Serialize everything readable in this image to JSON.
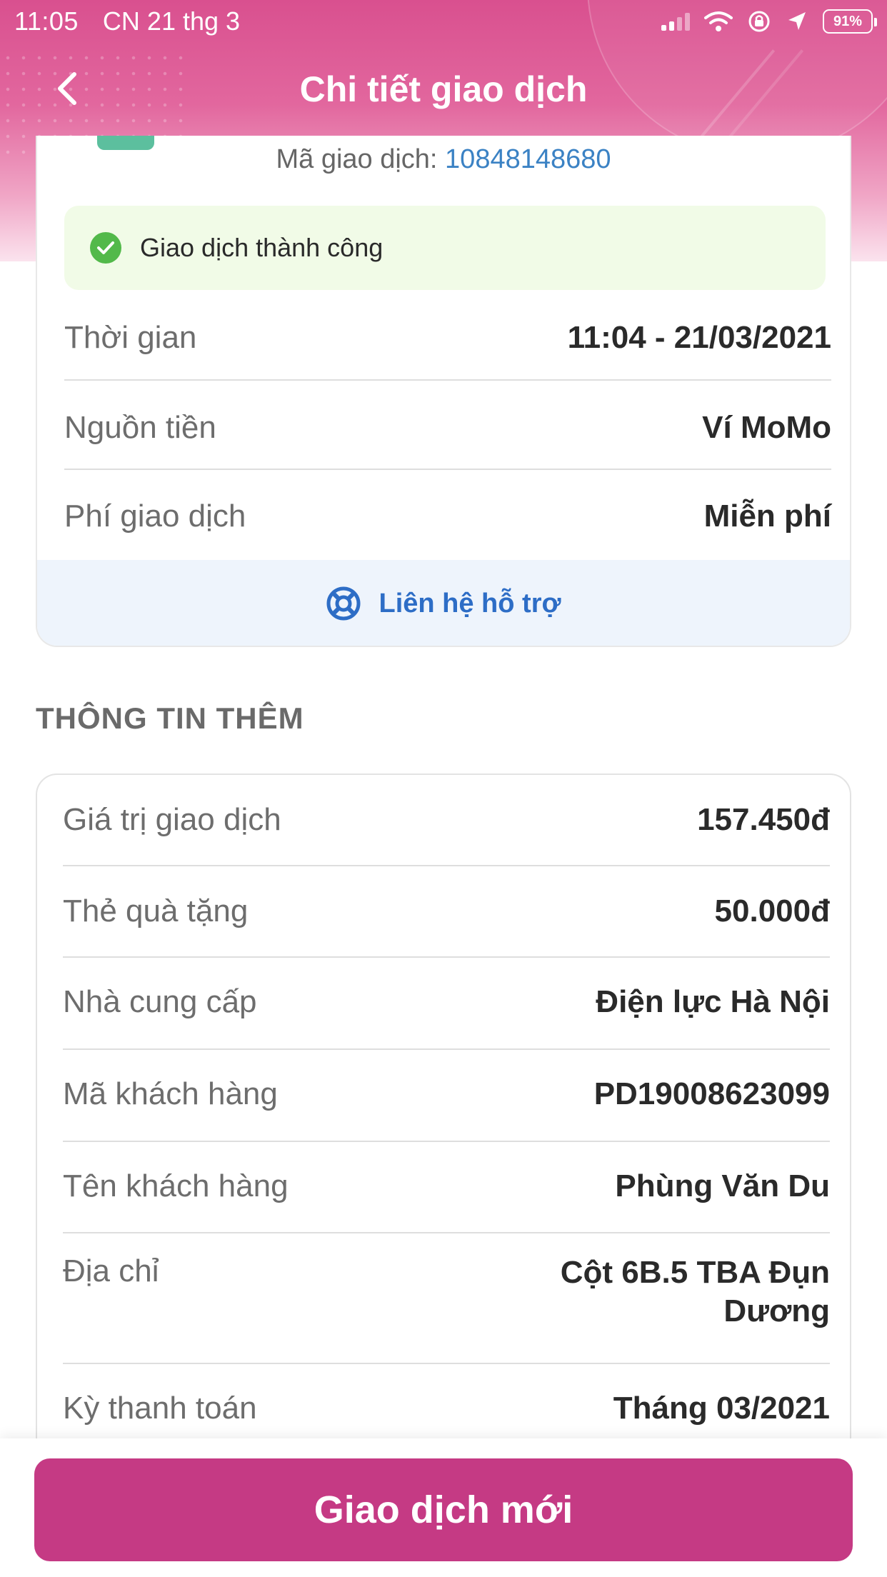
{
  "status_bar": {
    "time": "11:05",
    "date": "CN 21 thg 3",
    "battery": "91%"
  },
  "nav": {
    "title": "Chi tiết giao dịch"
  },
  "transaction": {
    "id_label": "Mã giao dịch: ",
    "id_value": "10848148680",
    "status": "Giao dịch thành công",
    "rows": [
      {
        "label": "Thời gian",
        "value": "11:04 - 21/03/2021"
      },
      {
        "label": "Nguồn tiền",
        "value": "Ví MoMo"
      },
      {
        "label": "Phí giao dịch",
        "value": "Miễn phí"
      }
    ],
    "support_label": "Liên hệ hỗ trợ"
  },
  "more_info": {
    "title": "THÔNG TIN THÊM",
    "rows": [
      {
        "label": "Giá trị giao dịch",
        "value": "157.450đ"
      },
      {
        "label": "Thẻ quà tặng",
        "value": "50.000đ"
      },
      {
        "label": "Nhà cung cấp",
        "value": "Điện lực Hà Nội"
      },
      {
        "label": "Mã khách hàng",
        "value": "PD19008623099"
      },
      {
        "label": "Tên khách hàng",
        "value": "Phùng Văn Du"
      },
      {
        "label": "Địa chỉ",
        "value_line1": "Cột 6B.5 TBA Đụn",
        "value_line2": "Dương"
      },
      {
        "label": "Kỳ thanh toán",
        "value": "Tháng 03/2021"
      }
    ]
  },
  "footer": {
    "button_label": "Giao dịch mới"
  },
  "colors": {
    "brand_pink": "#c53a84",
    "link_blue": "#3b82c4",
    "success_green": "#52b94a"
  }
}
